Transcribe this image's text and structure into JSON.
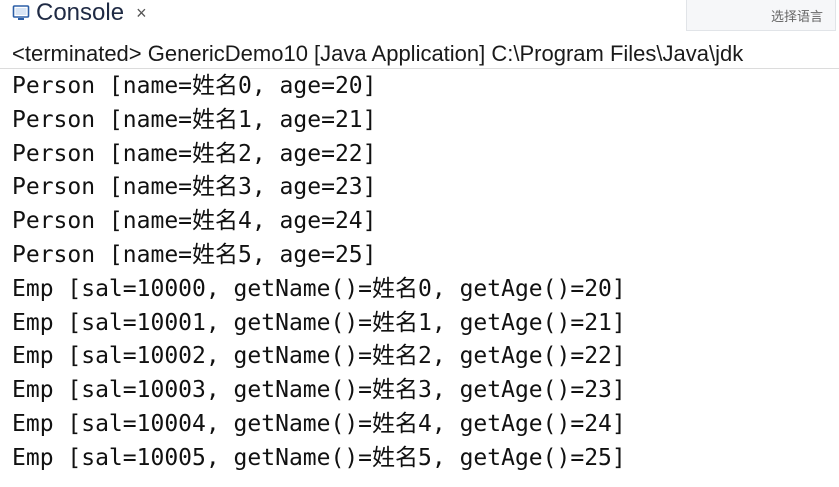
{
  "tab": {
    "label": "Console",
    "close_glyph": "×",
    "icon": "console-icon"
  },
  "ime_toolbar": {
    "label": "选择语言"
  },
  "status": {
    "text": "<terminated> GenericDemo10 [Java Application] C:\\Program Files\\Java\\jdk"
  },
  "output_lines": [
    "Person [name=姓名0, age=20]",
    "Person [name=姓名1, age=21]",
    "Person [name=姓名2, age=22]",
    "Person [name=姓名3, age=23]",
    "Person [name=姓名4, age=24]",
    "Person [name=姓名5, age=25]",
    "Emp [sal=10000, getName()=姓名0, getAge()=20]",
    "Emp [sal=10001, getName()=姓名1, getAge()=21]",
    "Emp [sal=10002, getName()=姓名2, getAge()=22]",
    "Emp [sal=10003, getName()=姓名3, getAge()=23]",
    "Emp [sal=10004, getName()=姓名4, getAge()=24]",
    "Emp [sal=10005, getName()=姓名5, getAge()=25]"
  ],
  "colors": {
    "text": "#111111",
    "tab_text": "#1f2a44",
    "icon": "#2b5ea7"
  }
}
